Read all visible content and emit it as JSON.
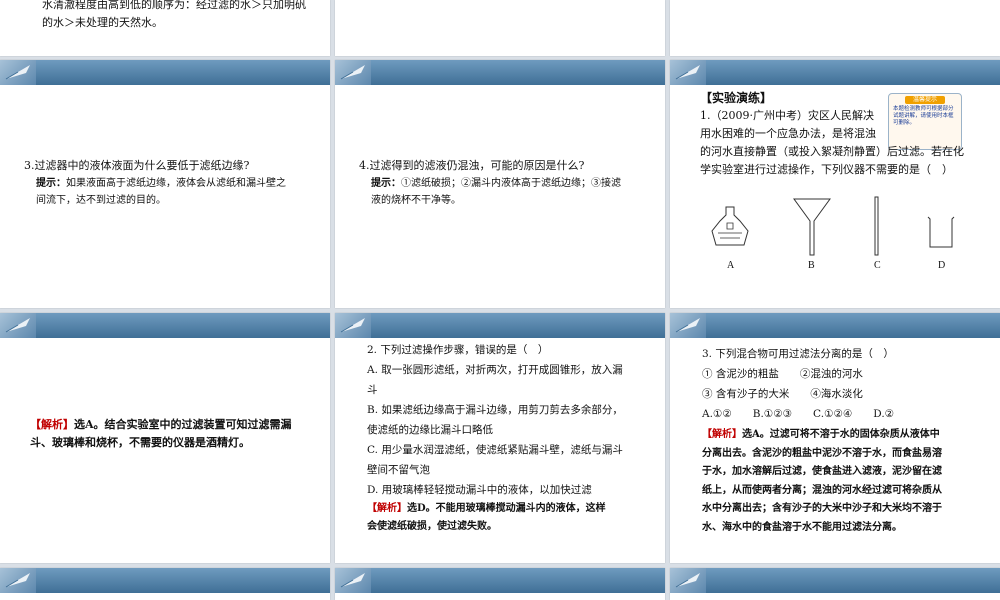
{
  "slide_top_left": {
    "line1": "水清澈程度由高到低的顺序为：经过滤的水＞只加明矾",
    "line2": "的水＞未处理的天然水。"
  },
  "slide_q3": {
    "question": "3.过滤器中的液体液面为什么要低于滤纸边缘?",
    "hint_label": "提示：",
    "hint_l1": "如果液面高于滤纸边缘，液体会从滤纸和漏斗壁之",
    "hint_l2": "间流下，达不到过滤的目的。"
  },
  "slide_q4": {
    "question": "4.过滤得到的滤液仍混浊，可能的原因是什么?",
    "hint_label": "提示：",
    "hint_l1": "①滤纸破损；②漏斗内液体高于滤纸边缘；③接滤",
    "hint_l2": "液的烧杯不干净等。"
  },
  "slide_exp": {
    "heading": "【实验演练】",
    "badge_title": "温馨提示",
    "badge_text": "本题检测教师可根据部分试题讲解，请使用时本框可删除。",
    "q_l1": "1.（2009·广州中考）灾区人民解决",
    "q_l2": "用水困难的一个应急办法，是将混浊",
    "q_l3": "的河水直接静置（或投入絮凝剂静置）后过滤。若在化",
    "q_l4": "学实验室进行过滤操作，下列仪器不需要的是（　）",
    "labels": [
      "A",
      "B",
      "C",
      "D"
    ],
    "icons": [
      "alcohol-lamp-icon",
      "funnel-icon",
      "glass-rod-icon",
      "beaker-icon"
    ]
  },
  "slide_ans1": {
    "tag": "【解析】",
    "l1": "选A。结合实验室中的过滤装置可知过滤需漏",
    "l2": "斗、玻璃棒和烧杯，不需要的仪器是酒精灯。"
  },
  "slide_q2": {
    "question": "2. 下列过滤操作步骤，错误的是（　）",
    "opt_a1": "A. 取一张圆形滤纸，对折两次，打开成圆锥形，放入漏",
    "opt_a2": "斗",
    "opt_b1": "B. 如果滤纸边缘高于漏斗边缘，用剪刀剪去多余部分，",
    "opt_b2": "使滤纸的边缘比漏斗口略低",
    "opt_c1": "C. 用少量水润湿滤纸，使滤纸紧贴漏斗壁，滤纸与漏斗",
    "opt_c2": "壁间不留气泡",
    "opt_d": "D. 用玻璃棒轻轻搅动漏斗中的液体，以加快过滤",
    "ans_tag": "【解析】",
    "ans_l1": "选D。不能用玻璃棒搅动漏斗内的液体，这样",
    "ans_l2": "会使滤纸破损，使过滤失败。"
  },
  "slide_q3b": {
    "question": "3. 下列混合物可用过滤法分离的是（　）",
    "items_l1a": "① 含泥沙的粗盐",
    "items_l1b": "②混浊的河水",
    "items_l2a": "③ 含有沙子的大米",
    "items_l2b": "④海水淡化",
    "choices": "A.①②　　B.①②③　　C.①②④　　D.②",
    "ans_tag": "【解析】",
    "ans_l1": "选A。过滤可将不溶于水的固体杂质从液体中",
    "ans_l2": "分离出去。含泥沙的粗盐中泥沙不溶于水，而食盐易溶",
    "ans_l3": "于水，加水溶解后过滤，使食盐进入滤液，泥沙留在滤",
    "ans_l4": "纸上，从而使两者分离；混浊的河水经过滤可将杂质从",
    "ans_l5": "水中分离出去；含有沙子的大米中沙子和大米均不溶于",
    "ans_l6": "水、海水中的食盐溶于水不能用过滤法分离。"
  },
  "colors": {
    "band": "#4f7fa8",
    "answer": "#c00000"
  }
}
